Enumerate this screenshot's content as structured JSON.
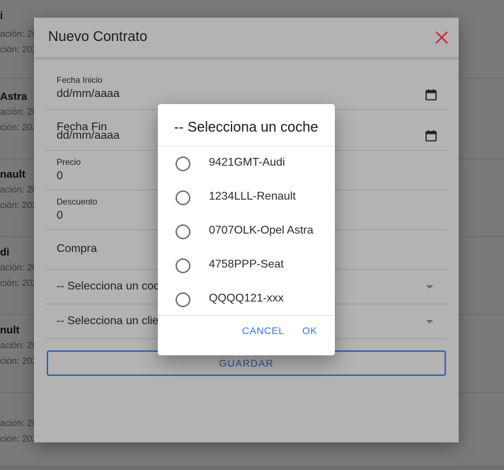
{
  "background_list": {
    "items": [
      {
        "title": "i",
        "line1": "ación: 20",
        "line2": "ción: 202"
      },
      {
        "title": " Astra",
        "line1": "ación: 20",
        "line2": "ción: 202"
      },
      {
        "title": "nault",
        "line1": "ación: 20",
        "line2": "ción: 202"
      },
      {
        "title": "di",
        "line1": "ación: 20",
        "line2": "ción: 202"
      },
      {
        "title": "nult",
        "line1": "ación: 20",
        "line2": "ción: 202"
      },
      {
        "title": "",
        "line1": "ación: 20",
        "line2": "ción: 202"
      }
    ]
  },
  "modal": {
    "title": "Nuevo Contrato",
    "close_icon": "close-icon",
    "fields": {
      "fecha_inicio": {
        "label": "Fecha Inicio",
        "value": "dd/mm/aaaa"
      },
      "fecha_fin": {
        "label": "Fecha Fin",
        "value": "dd/mm/aaaa"
      },
      "precio": {
        "label": "Precio",
        "value": "0"
      },
      "descuento": {
        "label": "Descuento",
        "value": "0"
      },
      "compra": {
        "value": "Compra"
      },
      "coche_select": {
        "value": "-- Selecciona un coc"
      },
      "cliente_select": {
        "value": "-- Selecciona un clie"
      }
    },
    "save_label": "GUARDAR"
  },
  "dialog": {
    "title": "-- Selecciona un coche",
    "options": [
      {
        "label": "9421GMT-Audi"
      },
      {
        "label": "1234LLL-Renault"
      },
      {
        "label": "0707OLK-Opel Astra"
      },
      {
        "label": "4758PPP-Seat"
      },
      {
        "label": "QQQQ121-xxx"
      }
    ],
    "cancel_label": "CANCEL",
    "ok_label": "OK"
  },
  "colors": {
    "accent": "#3b74d6",
    "close": "#c8283a",
    "save_border": "#2f62b5"
  }
}
